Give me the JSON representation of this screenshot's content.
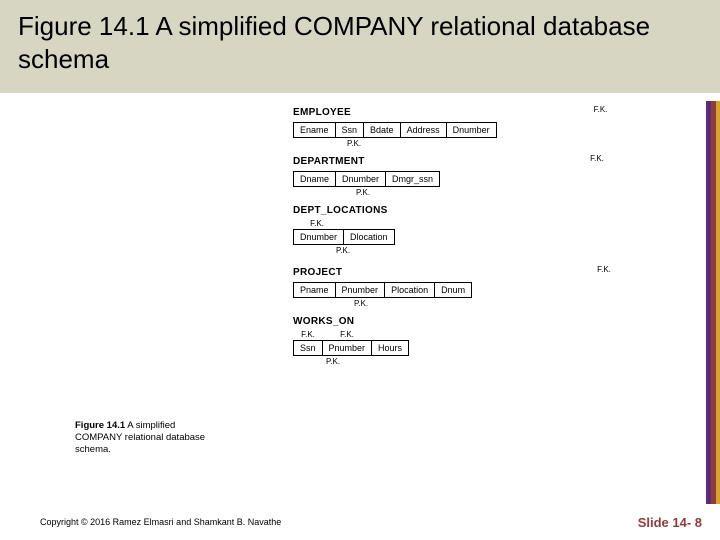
{
  "title": "Figure 14.1 A simplified COMPANY relational database schema",
  "fk_label": "F.K.",
  "pk_label": "P.K.",
  "relations": {
    "employee": {
      "name": "EMPLOYEE",
      "attrs": [
        "Ename",
        "Ssn",
        "Bdate",
        "Address",
        "Dnumber"
      ]
    },
    "department": {
      "name": "DEPARTMENT",
      "attrs": [
        "Dname",
        "Dnumber",
        "Dmgr_ssn"
      ]
    },
    "dept_locations": {
      "name": "DEPT_LOCATIONS",
      "attrs": [
        "Dnumber",
        "Dlocation"
      ]
    },
    "project": {
      "name": "PROJECT",
      "attrs": [
        "Pname",
        "Pnumber",
        "Plocation",
        "Dnum"
      ]
    },
    "works_on": {
      "name": "WORKS_ON",
      "attrs": [
        "Ssn",
        "Pnumber",
        "Hours"
      ]
    }
  },
  "caption": {
    "fig": "Figure 14.1",
    "text": "A simplified COMPANY relational database schema."
  },
  "footer": {
    "copyright": "Copyright © 2016 Ramez Elmasri and Shamkant B. Navathe",
    "slide": "Slide 14- 8"
  }
}
